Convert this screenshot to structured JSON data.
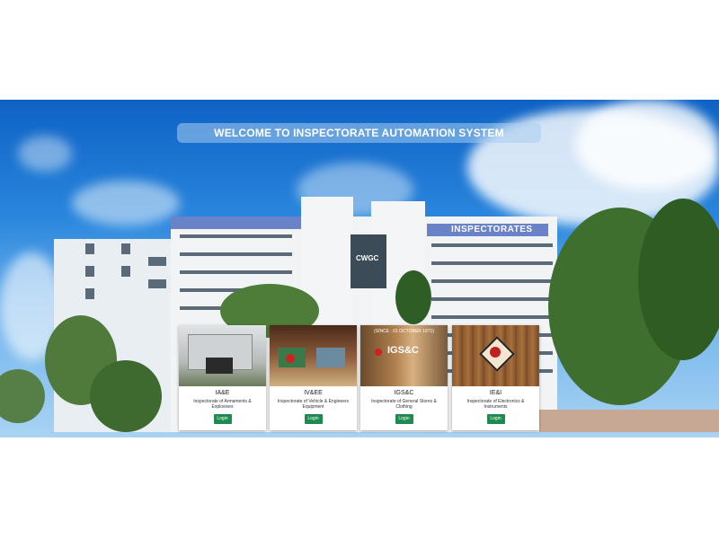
{
  "banner": {
    "title": "WELCOME TO INSPECTORATE AUTOMATION SYSTEM"
  },
  "building": {
    "sign_main": "INSPECTORATES",
    "sign_cwgc": "CWGC"
  },
  "cards": [
    {
      "title": "IA&E",
      "description": "Inspectorate of Armaments & Explosives",
      "button": "Login",
      "image": "ia-e-building-icon"
    },
    {
      "title": "IV&EE",
      "description": "Inspectorate of Vehicle & Engineers Equipment",
      "button": "Login",
      "image": "iv-ee-hall-icon"
    },
    {
      "title": "IGS&C",
      "description": "Inspectorate of General Stores & Clothing",
      "button": "Login",
      "image": "igs-c-plaque-icon",
      "plaque_text": "IGS&C",
      "plaque_top": "(SINCE : 01 OCTOBER 1971)"
    },
    {
      "title": "IE&I",
      "description": "Inspectorate of Electronics & Instruments",
      "button": "Login",
      "image": "ie-i-emblem-icon"
    }
  ],
  "colors": {
    "button": "#1f8a4f",
    "sky": "#2a86dd"
  }
}
